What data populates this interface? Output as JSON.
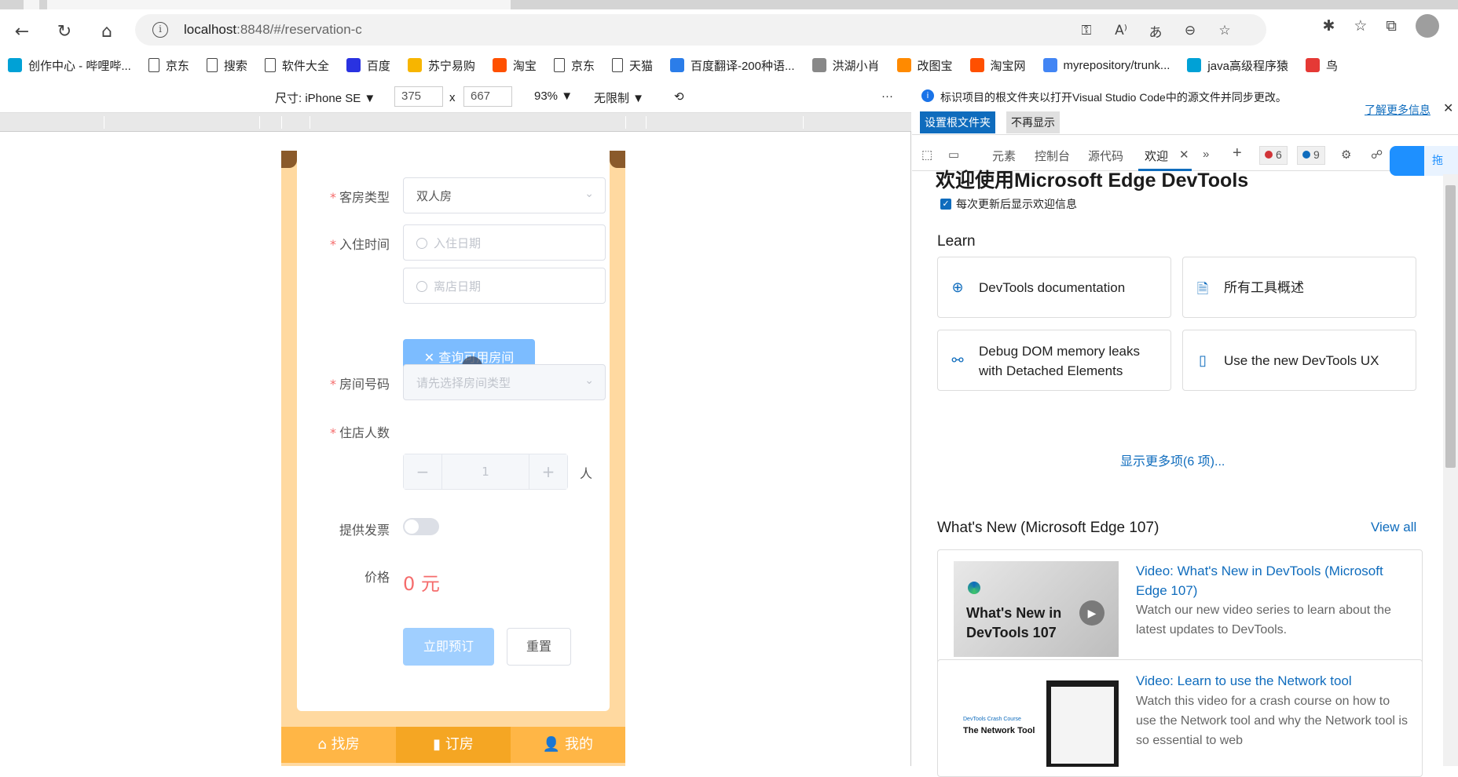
{
  "browser": {
    "url_host": "localhost",
    "url_rest": ":8848/#/reservation-c"
  },
  "bookmarks": [
    {
      "label": "创作中心 - 哔哩哔...",
      "color": "#00a1d6"
    },
    {
      "label": "京东",
      "color": "page"
    },
    {
      "label": "搜索",
      "color": "page"
    },
    {
      "label": "软件大全",
      "color": "page"
    },
    {
      "label": "百度",
      "color": "#2932e1"
    },
    {
      "label": "苏宁易购",
      "color": "#f7b500"
    },
    {
      "label": "淘宝",
      "color": "#ff5000"
    },
    {
      "label": "京东",
      "color": "page"
    },
    {
      "label": "天猫",
      "color": "page"
    },
    {
      "label": "百度翻译-200种语...",
      "color": "#2b7de9"
    },
    {
      "label": "洪湖小肖",
      "color": "#888888"
    },
    {
      "label": "改图宝",
      "color": "#ff8a00"
    },
    {
      "label": "淘宝网",
      "color": "#ff5000"
    },
    {
      "label": "myrepository/trunk...",
      "color": "#4285f4"
    },
    {
      "label": "java高级程序猿",
      "color": "#00a1d6"
    },
    {
      "label": "鸟",
      "color": "#e53935"
    }
  ],
  "devbar": {
    "size_label": "尺寸: iPhone SE ▼",
    "width": "375",
    "times": "x",
    "height": "667",
    "zoom": "93% ▼",
    "throttle": "无限制 ▼",
    "more": "···"
  },
  "form": {
    "room_type_label": "客房类型",
    "room_type_value": "双人房",
    "checkin_label": "入住时间",
    "checkin_placeholder": "入住日期",
    "checkout_placeholder": "离店日期",
    "query_button": "✕ 查询可用房间",
    "room_no_label": "房间号码",
    "room_no_placeholder": "请先选择房间类型",
    "guests_label": "住店人数",
    "guests_value": "1",
    "guests_unit": "人",
    "invoice_label": "提供发票",
    "price_label": "价格",
    "price_value": "0 元",
    "book_button": "立即预订",
    "reset_button": "重置"
  },
  "tabbar": {
    "find": "⌂ 找房",
    "order": "▮ 订房",
    "mine": "👤 我的"
  },
  "devtools": {
    "info_message": "标识项目的根文件夹以打开Visual Studio Code中的源文件并同步更改。",
    "set_root": "设置根文件夹",
    "dont_show": "不再显示",
    "learn_more": "了解更多信息",
    "tabs": [
      "元素",
      "控制台",
      "源代码",
      "欢迎"
    ],
    "errors": "6",
    "messages": "9",
    "float_label": "拖",
    "welcome_title": "欢迎使用Microsoft Edge DevTools",
    "show_each_time": "每次更新后显示欢迎信息",
    "learn_heading": "Learn",
    "learn_cards": [
      {
        "label": "DevTools documentation",
        "icon": "docs-icon"
      },
      {
        "label": "所有工具概述",
        "icon": "document-icon"
      },
      {
        "label": "Debug DOM memory leaks with Detached Elements",
        "icon": "link-icon"
      },
      {
        "label": "Use the new DevTools UX",
        "icon": "panel-icon"
      }
    ],
    "show_more": "显示更多项(6 项)...",
    "whats_new": "What's New (Microsoft Edge 107)",
    "view_all": "View all",
    "videos": [
      {
        "thumb_text": "What's New in DevTools 107",
        "title": "Video: What's New in DevTools (Microsoft Edge 107)",
        "desc": "Watch our new video series to learn about the latest updates to DevTools."
      },
      {
        "thumb_text": "The Network Tool",
        "thumb_small": "DevTools Crash Course",
        "title": "Video: Learn to use the Network tool",
        "desc": "Watch this video for a crash course on how to use the Network tool and why the Network tool is so essential to web"
      }
    ]
  }
}
